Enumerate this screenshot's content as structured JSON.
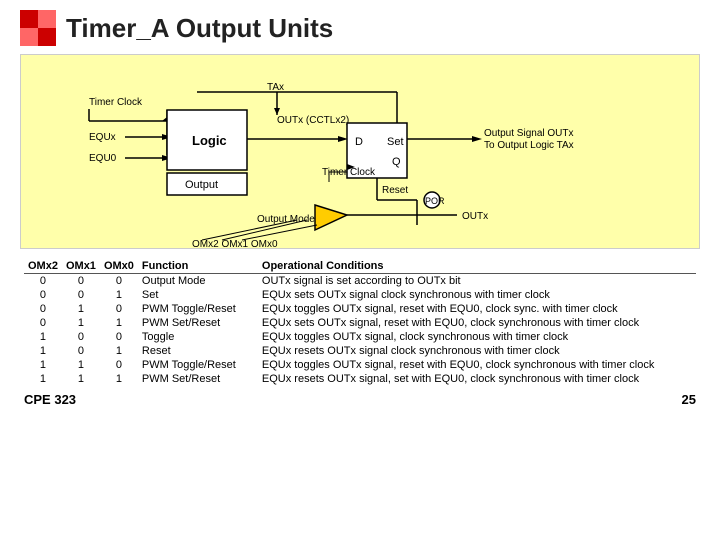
{
  "title": "Timer_A Output Units",
  "table": {
    "headers": [
      "OMx2",
      "OMx1",
      "OMx0",
      "Function",
      "Operational Conditions"
    ],
    "rows": [
      [
        "0",
        "0",
        "0",
        "Output Mode",
        "OUTx signal is set according to OUTx bit"
      ],
      [
        "0",
        "0",
        "1",
        "Set",
        "EQUx sets OUTx signal clock synchronous with timer clock"
      ],
      [
        "0",
        "1",
        "0",
        "PWM Toggle/Reset",
        "EQUx toggles OUTx signal, reset with EQU0, clock sync. with timer clock"
      ],
      [
        "0",
        "1",
        "1",
        "PWM Set/Reset",
        "EQUx sets OUTx signal, reset with EQU0, clock synchronous with timer clock"
      ],
      [
        "1",
        "0",
        "0",
        "Toggle",
        "EQUx toggles OUTx signal, clock synchronous with timer clock"
      ],
      [
        "1",
        "0",
        "1",
        "Reset",
        "EQUx resets OUTx signal clock synchronous with timer clock"
      ],
      [
        "1",
        "1",
        "0",
        "PWM Toggle/Reset",
        "EQUx toggles OUTx signal, reset with EQU0, clock synchronous with timer clock"
      ],
      [
        "1",
        "1",
        "1",
        "PWM Set/Reset",
        "EQUx resets OUTx signal, set with EQU0, clock synchronous with timer clock"
      ]
    ]
  },
  "footer": {
    "course": "CPE 323",
    "page": "25"
  }
}
